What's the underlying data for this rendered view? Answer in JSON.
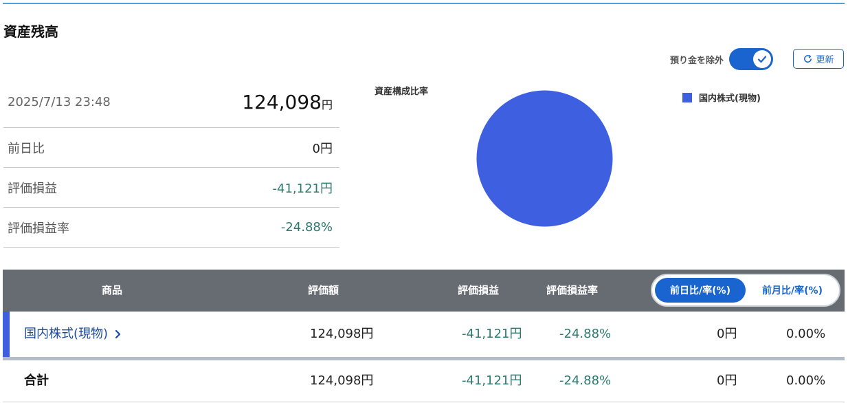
{
  "title": "資産残高",
  "controls": {
    "toggle_label": "預り金を除外",
    "toggle_on": true,
    "refresh_label": "更新"
  },
  "summary": {
    "datetime": "2025/7/13 23:48",
    "total_value": "124,098",
    "total_unit": "円",
    "rows": [
      {
        "label": "前日比",
        "value": "0円"
      },
      {
        "label": "評価損益",
        "value": "-41,121円"
      },
      {
        "label": "評価損益率",
        "value": "-24.88%"
      }
    ]
  },
  "chart_data": {
    "type": "pie",
    "title": "資産構成比率",
    "categories": [
      "国内株式(現物)"
    ],
    "values": [
      100
    ],
    "colors": [
      "#3d5fe0"
    ],
    "legend_position": "top-right"
  },
  "table": {
    "headers": [
      "商品",
      "評価額",
      "評価損益",
      "評価損益率"
    ],
    "segment": {
      "active": "前日比/率(%)",
      "inactive": "前月比/率(%)"
    },
    "rows": [
      {
        "name": "国内株式(現物)",
        "value": "124,098円",
        "pl": "-41,121円",
        "pl_rate": "-24.88%",
        "change": "0円",
        "change_rate": "0.00%"
      }
    ],
    "total": {
      "label": "合計",
      "value": "124,098円",
      "pl": "-41,121円",
      "pl_rate": "-24.88%",
      "change": "0円",
      "change_rate": "0.00%"
    }
  }
}
